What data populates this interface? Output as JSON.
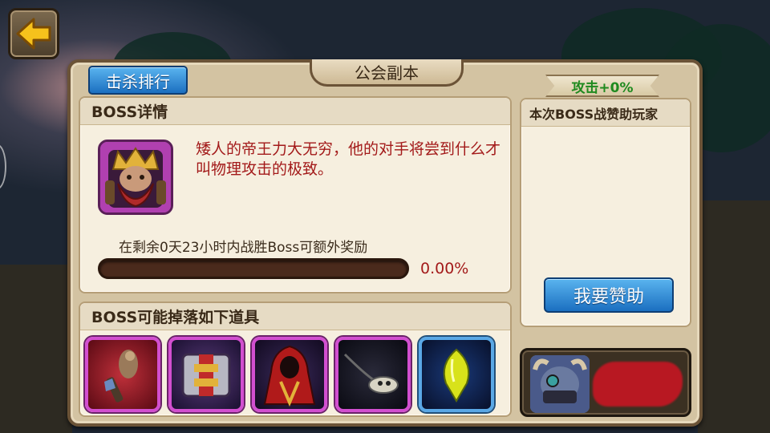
{
  "title": "公会副本",
  "rank_button": "击杀排行",
  "boss_section": {
    "heading": "BOSS详情",
    "description": "矮人的帝王力大无穷，他的对手将尝到什么才叫物理攻击的极致。",
    "timer_text": "在剩余0天23小时内战胜Boss可额外奖励",
    "progress_percent_text": "0.00%",
    "progress_value": 0
  },
  "drops_section": {
    "heading": "BOSS可能掉落如下道具",
    "items": [
      {
        "icon": "feathered-totem-icon",
        "rarity": "purple"
      },
      {
        "icon": "armor-chest-icon",
        "rarity": "purple"
      },
      {
        "icon": "hooded-cloak-icon",
        "rarity": "purple"
      },
      {
        "icon": "skull-necklace-icon",
        "rarity": "purple"
      },
      {
        "icon": "green-gem-icon",
        "rarity": "blue"
      }
    ]
  },
  "sponsor_section": {
    "attack_bonus": "攻击+0%",
    "heading": "本次BOSS战赞助玩家",
    "sponsor_button": "我要赞助"
  },
  "colors": {
    "accent_blue": "#1b6fc0",
    "desc_red": "#a31a1a",
    "bonus_green": "#1f8a1f",
    "purple_rarity": "#d24fd0",
    "blue_rarity": "#5aa8e6"
  }
}
